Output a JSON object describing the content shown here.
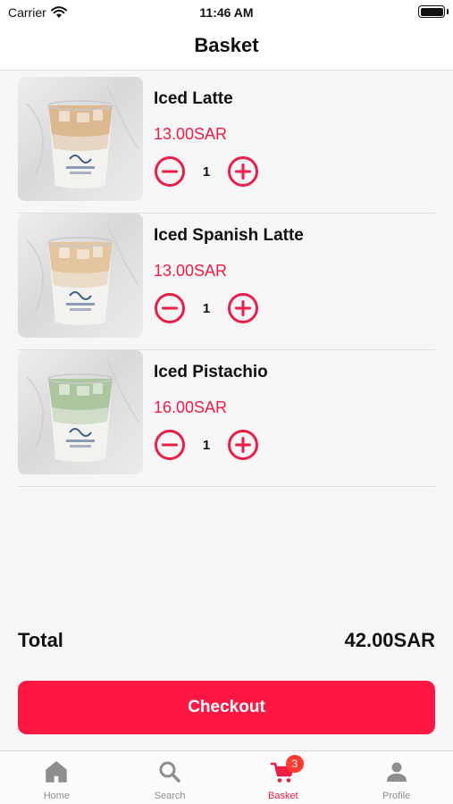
{
  "status_bar": {
    "carrier": "Carrier",
    "time": "11:46 AM"
  },
  "header": {
    "title": "Basket"
  },
  "items": [
    {
      "name": "Iced Latte",
      "price": "13.00SAR",
      "quantity": "1",
      "drink_color": "#d9b48a"
    },
    {
      "name": "Iced Spanish Latte",
      "price": "13.00SAR",
      "quantity": "1",
      "drink_color": "#e2c29a"
    },
    {
      "name": "Iced Pistachio",
      "price": "16.00SAR",
      "quantity": "1",
      "drink_color": "#a8c39a"
    }
  ],
  "summary": {
    "total_label": "Total",
    "total_value": "42.00SAR"
  },
  "checkout": {
    "label": "Checkout"
  },
  "tab_bar": {
    "tabs": [
      {
        "label": "Home",
        "icon": "home-icon"
      },
      {
        "label": "Search",
        "icon": "search-icon"
      },
      {
        "label": "Basket",
        "icon": "cart-icon",
        "badge": "3",
        "active": true
      },
      {
        "label": "Profile",
        "icon": "person-icon"
      }
    ]
  },
  "colors": {
    "accent": "#ff1744",
    "price": "#ee1c47",
    "badge": "#ff3b30",
    "inactive_tab": "#8e8e8e"
  }
}
